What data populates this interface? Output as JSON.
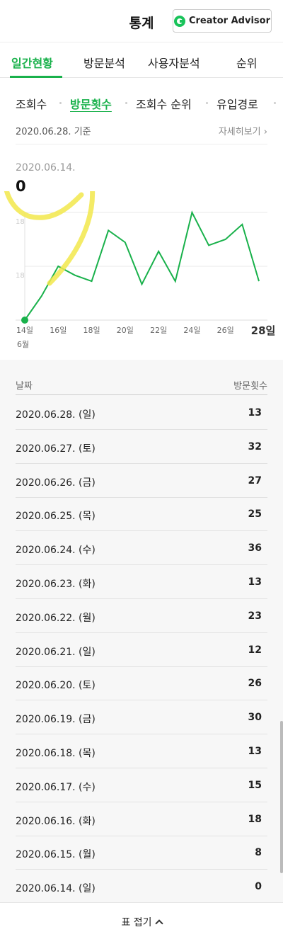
{
  "header": {
    "title": "통계",
    "creator_advisor_label": "Creator Advisor"
  },
  "tabs": [
    {
      "label": "일간현황",
      "active": true
    },
    {
      "label": "방문분석",
      "active": false
    },
    {
      "label": "사용자분석",
      "active": false
    },
    {
      "label": "순위",
      "active": false
    }
  ],
  "subtabs": [
    {
      "label": "조회수",
      "active": false
    },
    {
      "label": "방문횟수",
      "active": true
    },
    {
      "label": "조회수 순위",
      "active": false
    },
    {
      "label": "유입경로",
      "active": false
    }
  ],
  "chart_header": {
    "basis_text": "2020.06.28. 기준",
    "detail_link": "자세히보기"
  },
  "selected": {
    "date": "2020.06.14.",
    "value": "0"
  },
  "colors": {
    "accent": "#19b14b",
    "annotation": "#f2e84b"
  },
  "chart_data": {
    "type": "line",
    "x": [
      "14일",
      "15일",
      "16일",
      "17일",
      "18일",
      "19일",
      "20일",
      "21일",
      "22일",
      "23일",
      "24일",
      "25일",
      "26일",
      "27일",
      "28일"
    ],
    "tick_labels": [
      "14일",
      "16일",
      "18일",
      "20일",
      "22일",
      "24일",
      "26일",
      "28일"
    ],
    "month_label": "6월",
    "series": [
      {
        "values": [
          0,
          8,
          18,
          15,
          13,
          30,
          26,
          12,
          23,
          13,
          36,
          25,
          27,
          32,
          13
        ]
      }
    ],
    "y_labels": [
      "18",
      "18"
    ],
    "ylim": [
      0,
      36
    ],
    "grid": true
  },
  "table": {
    "headers": [
      "날짜",
      "방문횟수"
    ],
    "rows": [
      {
        "date": "2020.06.28. (일)",
        "value": "13"
      },
      {
        "date": "2020.06.27. (토)",
        "value": "32"
      },
      {
        "date": "2020.06.26. (금)",
        "value": "27"
      },
      {
        "date": "2020.06.25. (목)",
        "value": "25"
      },
      {
        "date": "2020.06.24. (수)",
        "value": "36"
      },
      {
        "date": "2020.06.23. (화)",
        "value": "13"
      },
      {
        "date": "2020.06.22. (월)",
        "value": "23"
      },
      {
        "date": "2020.06.21. (일)",
        "value": "12"
      },
      {
        "date": "2020.06.20. (토)",
        "value": "26"
      },
      {
        "date": "2020.06.19. (금)",
        "value": "30"
      },
      {
        "date": "2020.06.18. (목)",
        "value": "13"
      },
      {
        "date": "2020.06.17. (수)",
        "value": "15"
      },
      {
        "date": "2020.06.16. (화)",
        "value": "18"
      },
      {
        "date": "2020.06.15. (월)",
        "value": "8"
      },
      {
        "date": "2020.06.14. (일)",
        "value": "0"
      }
    ]
  },
  "fold_button_label": "표 접기"
}
